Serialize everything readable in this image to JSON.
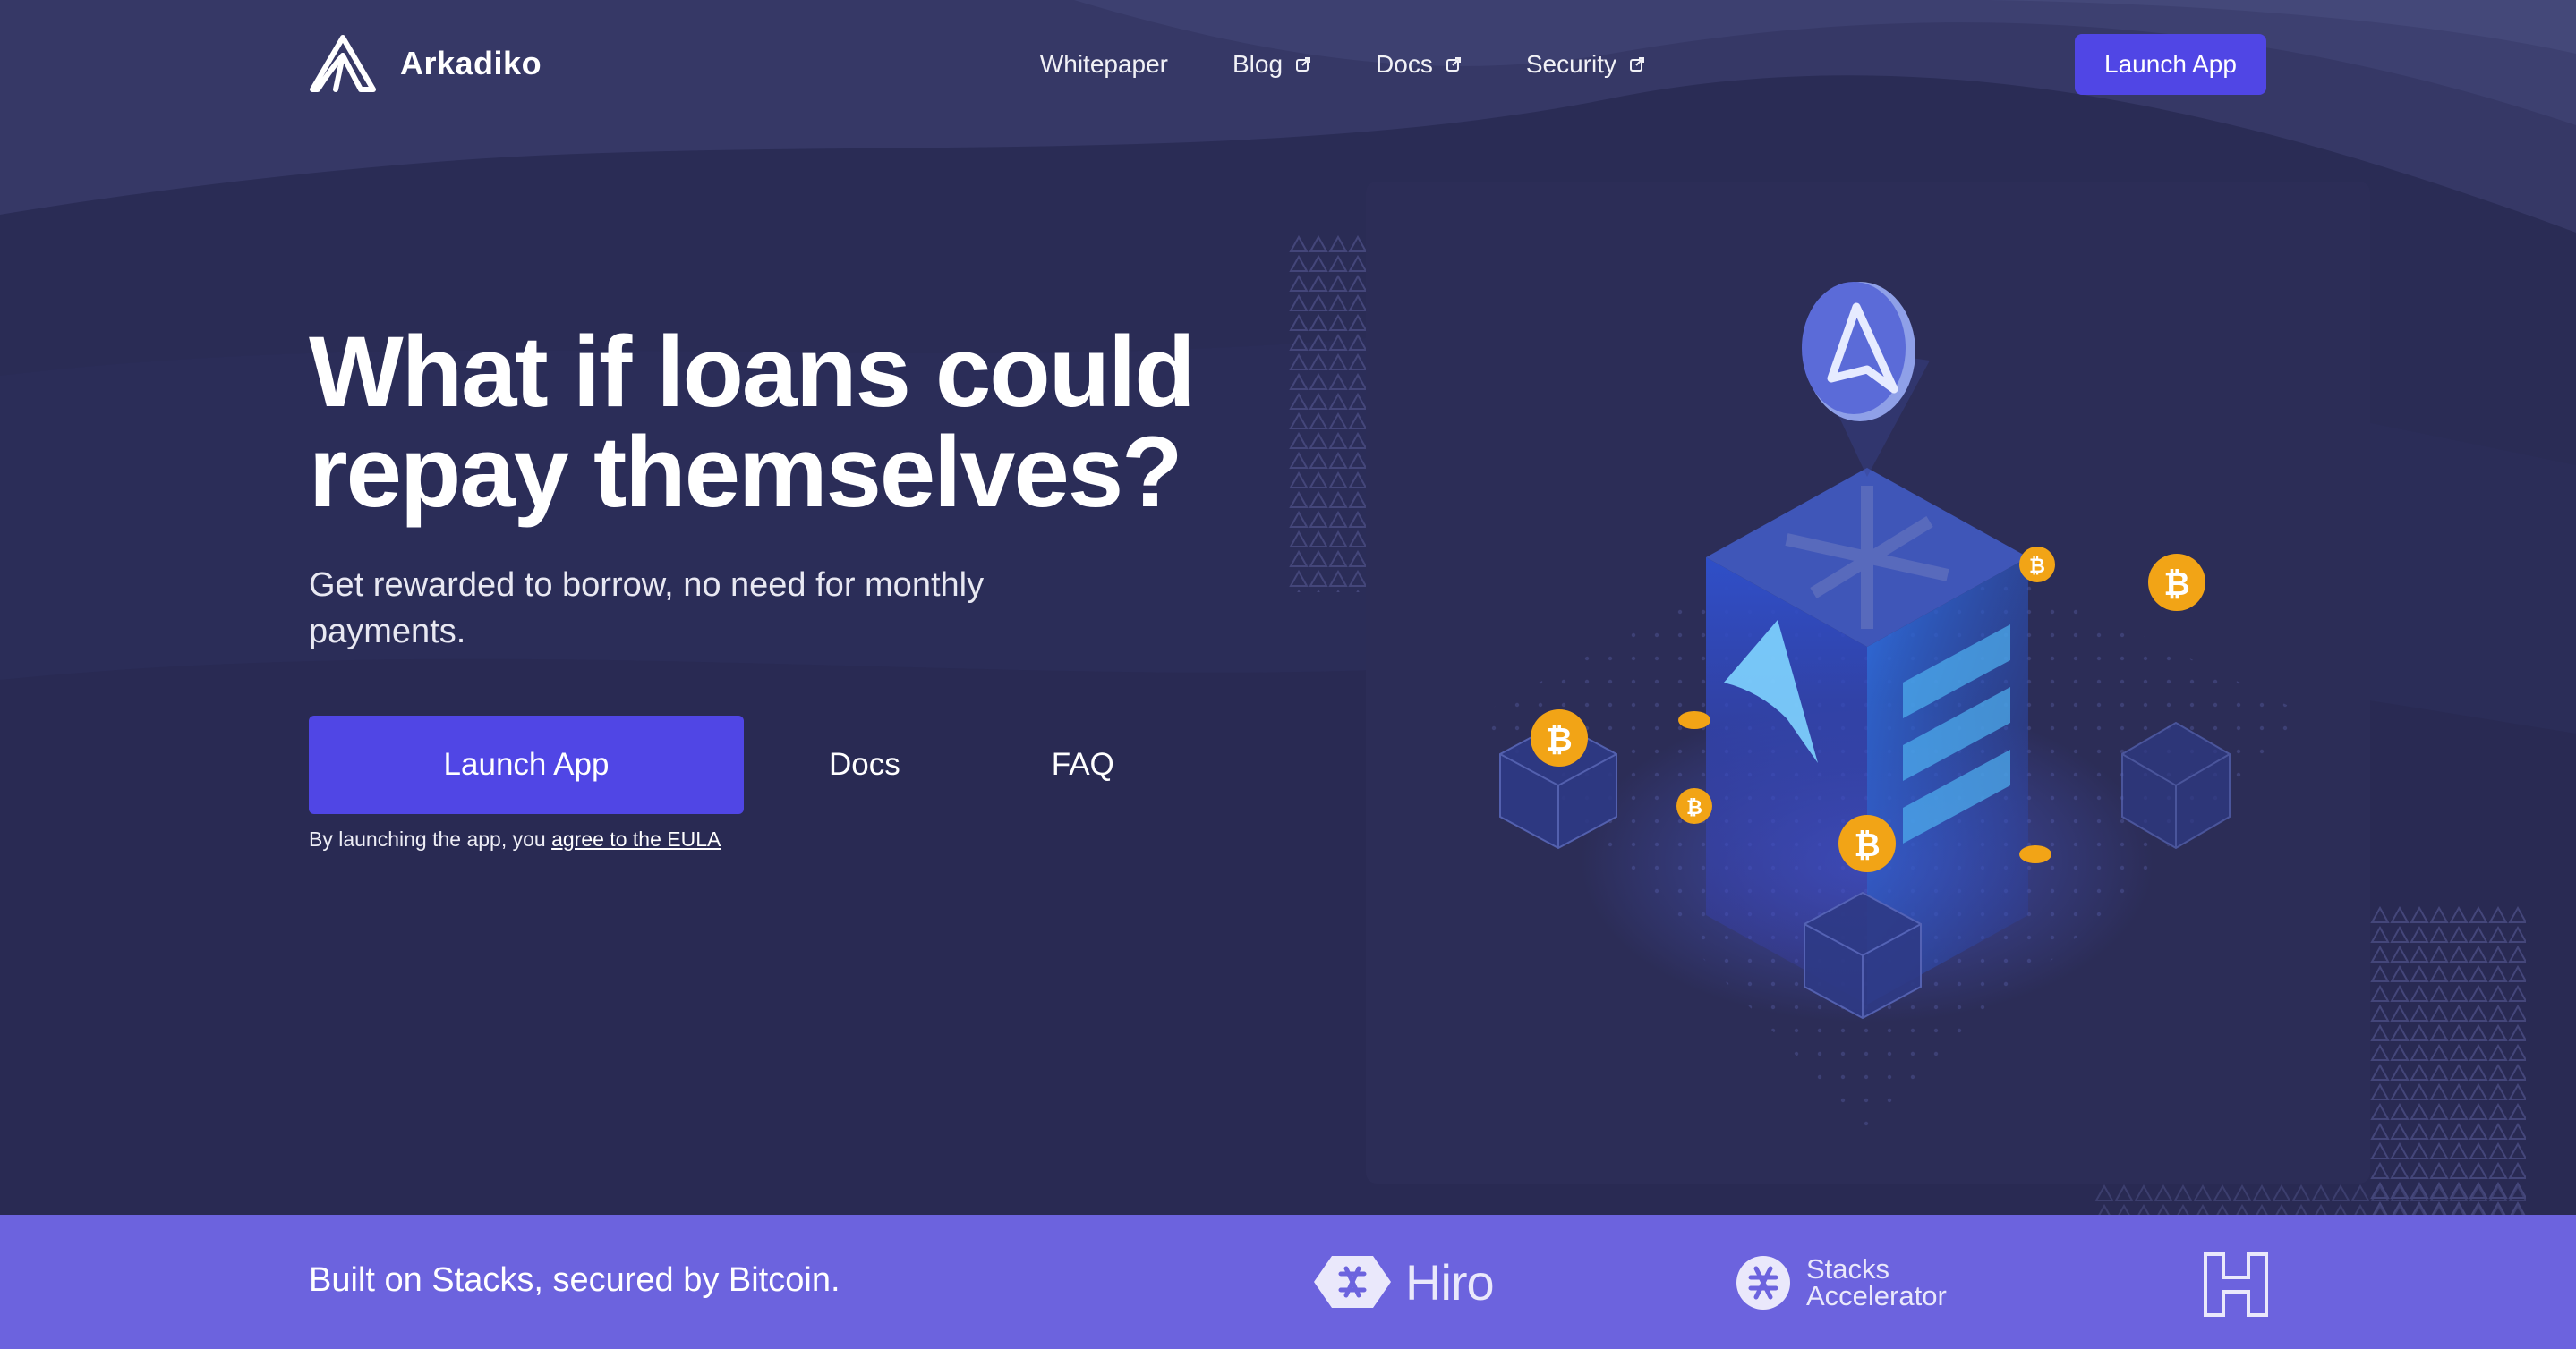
{
  "brand": {
    "name": "Arkadiko",
    "logo_icon": "arkadiko-logo-icon"
  },
  "nav": {
    "links": [
      {
        "label": "Whitepaper",
        "external": false
      },
      {
        "label": "Blog",
        "external": true
      },
      {
        "label": "Docs",
        "external": true
      },
      {
        "label": "Security",
        "external": true
      }
    ],
    "launch_label": "Launch App"
  },
  "hero": {
    "title_line1": "What if loans could",
    "title_line2": "repay themselves?",
    "subtitle": "Get rewarded to borrow, no need for monthly payments.",
    "launch_label": "Launch App",
    "docs_label": "Docs",
    "faq_label": "FAQ",
    "eula_prefix": "By launching the app, you ",
    "eula_link": "agree to the EULA"
  },
  "strip": {
    "text": "Built on Stacks, secured by Bitcoin.",
    "partners": {
      "hiro": "Hiro",
      "stacks_line1": "Stacks",
      "stacks_line2": "Accelerator"
    }
  },
  "colors": {
    "background": "#2a2c55",
    "accent": "#5046e5",
    "strip": "#6c63de",
    "bitcoin_coin": "#f2a416"
  }
}
